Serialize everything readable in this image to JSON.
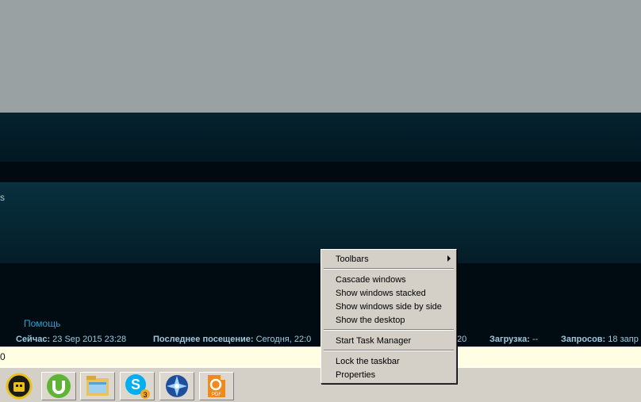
{
  "background": {
    "edge_text": "s"
  },
  "footer": {
    "help_link": "Помощь",
    "now_label": "Сейчас:",
    "now_value": "23 Sep 2015 23:28",
    "last_visit_label": "Последнее посещение:",
    "last_visit_value": "Сегодня, 22:0",
    "load_suffix": "20",
    "load_label": "Загрузка:",
    "load_value": "--",
    "requests_label": "Запросов:",
    "requests_value": "18 запр"
  },
  "address_bar": {
    "text": "0"
  },
  "taskbar": {
    "items": [
      {
        "name": "start-orb-icon"
      },
      {
        "name": "utorrent-icon"
      },
      {
        "name": "file-explorer-icon"
      },
      {
        "name": "skype-icon",
        "badge": "3"
      },
      {
        "name": "network-star-icon"
      },
      {
        "name": "foxit-pdf-icon",
        "label": "PDF"
      }
    ]
  },
  "context_menu": {
    "toolbars": "Toolbars",
    "cascade": "Cascade windows",
    "stacked": "Show windows stacked",
    "side_by_side": "Show windows side by side",
    "show_desktop": "Show the desktop",
    "task_manager": "Start Task Manager",
    "lock": "Lock the taskbar",
    "properties": "Properties"
  }
}
